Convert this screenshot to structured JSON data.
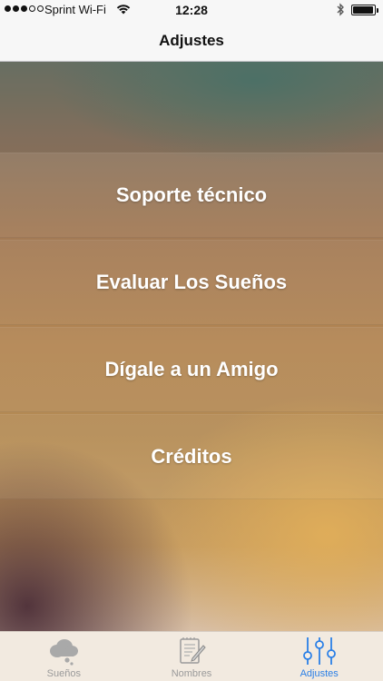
{
  "status_bar": {
    "carrier": "Sprint Wi-Fi",
    "time": "12:28",
    "signal_bars_filled": 3,
    "signal_bars_total": 5
  },
  "nav": {
    "title": "Adjustes"
  },
  "menu": {
    "items": [
      {
        "label": "Soporte técnico"
      },
      {
        "label": "Evaluar Los Sueños"
      },
      {
        "label": "Dígale a un Amigo"
      },
      {
        "label": "Créditos"
      }
    ]
  },
  "tabs": [
    {
      "label": "Sueños",
      "icon": "cloud-icon",
      "active": false
    },
    {
      "label": "Nombres",
      "icon": "notebook-pen-icon",
      "active": false
    },
    {
      "label": "Adjustes",
      "icon": "sliders-icon",
      "active": true
    }
  ],
  "colors": {
    "accent": "#2a7fe6",
    "inactive_tab": "#9a9a9a"
  }
}
